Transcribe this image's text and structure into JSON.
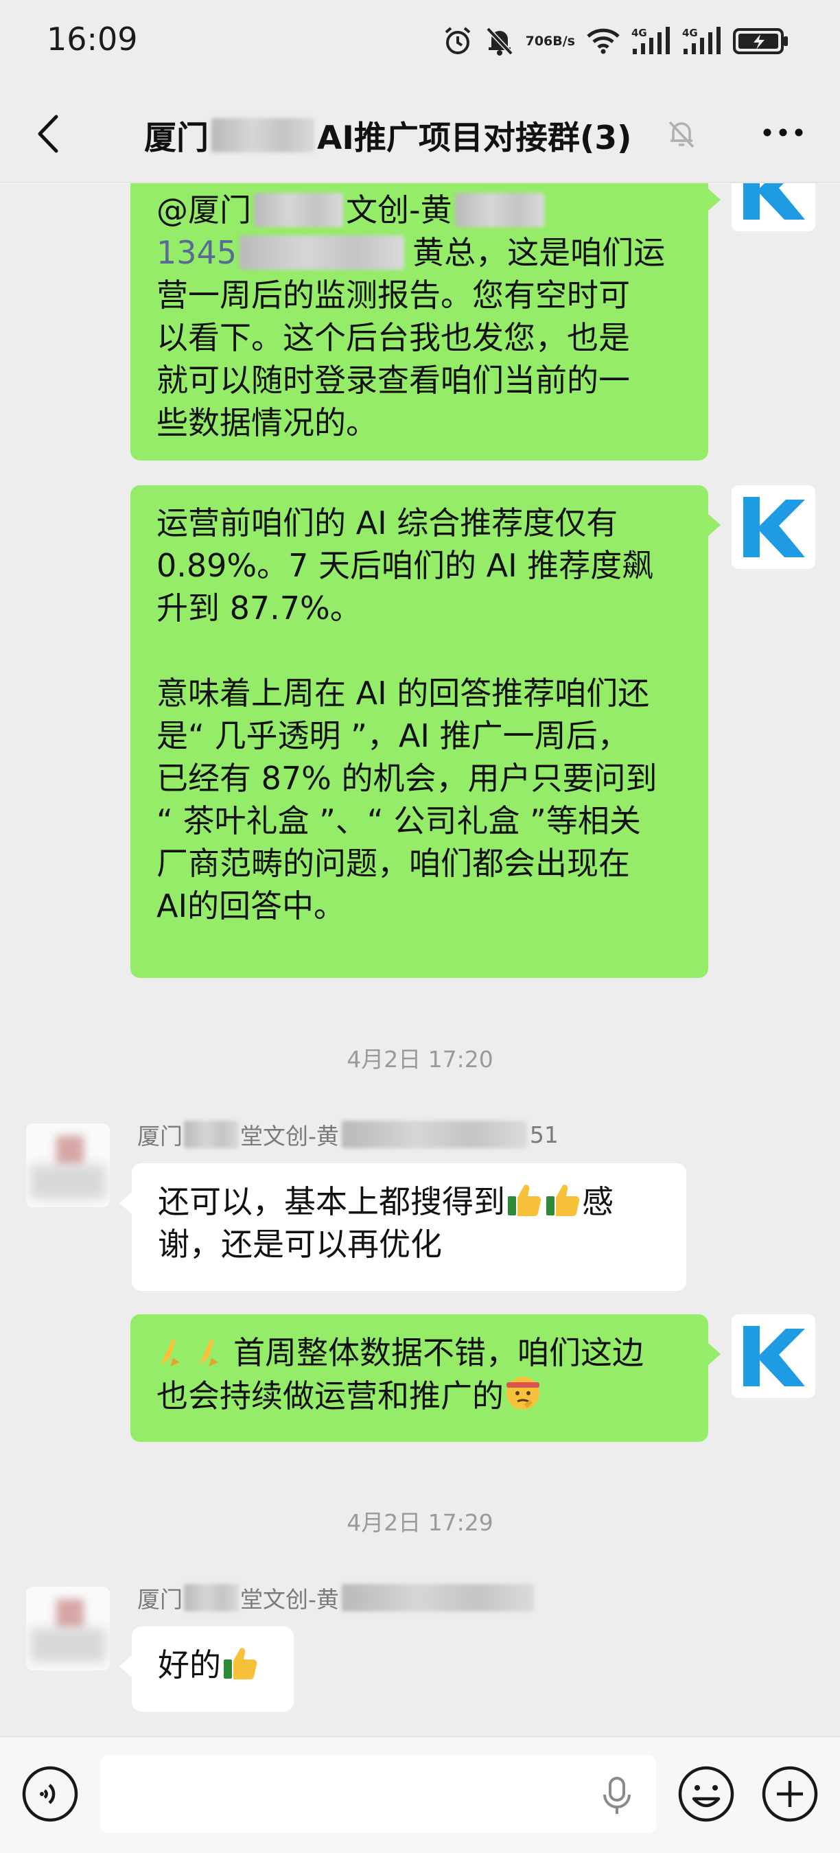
{
  "status_bar": {
    "time": "16:09",
    "net_speed_value": "706",
    "net_speed_unit": "B/s",
    "network_1": "4G",
    "network_2": "4G"
  },
  "header": {
    "title_prefix": "厦门",
    "title_suffix": "AI推广项目对接群(3)"
  },
  "messages": [
    {
      "side": "me",
      "lines_1": [
        "@厦门",
        "文创-黄"
      ],
      "mention_number": "1345",
      "line_2_tail": "黄总，这是咱们运",
      "lines": [
        "营一周后的监测报告。您有空时可",
        "以看下。这个后台我也发您，也是",
        "就可以随时登录查看咱们当前的一",
        "些数据情况的。"
      ]
    },
    {
      "side": "me",
      "lines": [
        "运营前咱们的 AI 综合推荐度仅有",
        "0.89%。7 天后咱们的 AI 推荐度飙",
        "升到 87.7%。",
        "",
        "意味着上周在 AI 的回答推荐咱们还",
        "是“ 几乎透明 ”，AI 推广一周后，",
        "已经有 87% 的机会，用户只要问到",
        "“ 茶叶礼盒 ”、“ 公司礼盒 ”等相关",
        "厂商范畴的问题，咱们都会出现在",
        "AI的回答中。"
      ]
    },
    {
      "side": "time",
      "text": "4月2日 17:20"
    },
    {
      "side": "other",
      "sender_prefix": "厦门",
      "sender_mid": "堂文创-黄",
      "sender_suffix": "51",
      "line_1": "还可以，基本上都搜得到",
      "line_1_tail": "感",
      "line_2": "谢，还是可以再优化"
    },
    {
      "side": "me",
      "line_1": "首周整体数据不错，咱们这边",
      "line_2": "也会持续做运营和推广的"
    },
    {
      "side": "time",
      "text": "4月2日 17:29"
    },
    {
      "side": "other",
      "sender_prefix": "厦门",
      "sender_mid": "堂文创-黄",
      "text": "好的"
    }
  ],
  "colors": {
    "my_bubble": "#95ec69",
    "other_bubble": "#ffffff",
    "background": "#ededed",
    "avatar_logo": "#1e9be3"
  },
  "icons": {
    "avatar_logo": "k-logo-icon",
    "thumbs_up": "thumbs-up-emoji",
    "pray": "pray-hands-emoji",
    "thinking": "thinking-face-emoji"
  }
}
